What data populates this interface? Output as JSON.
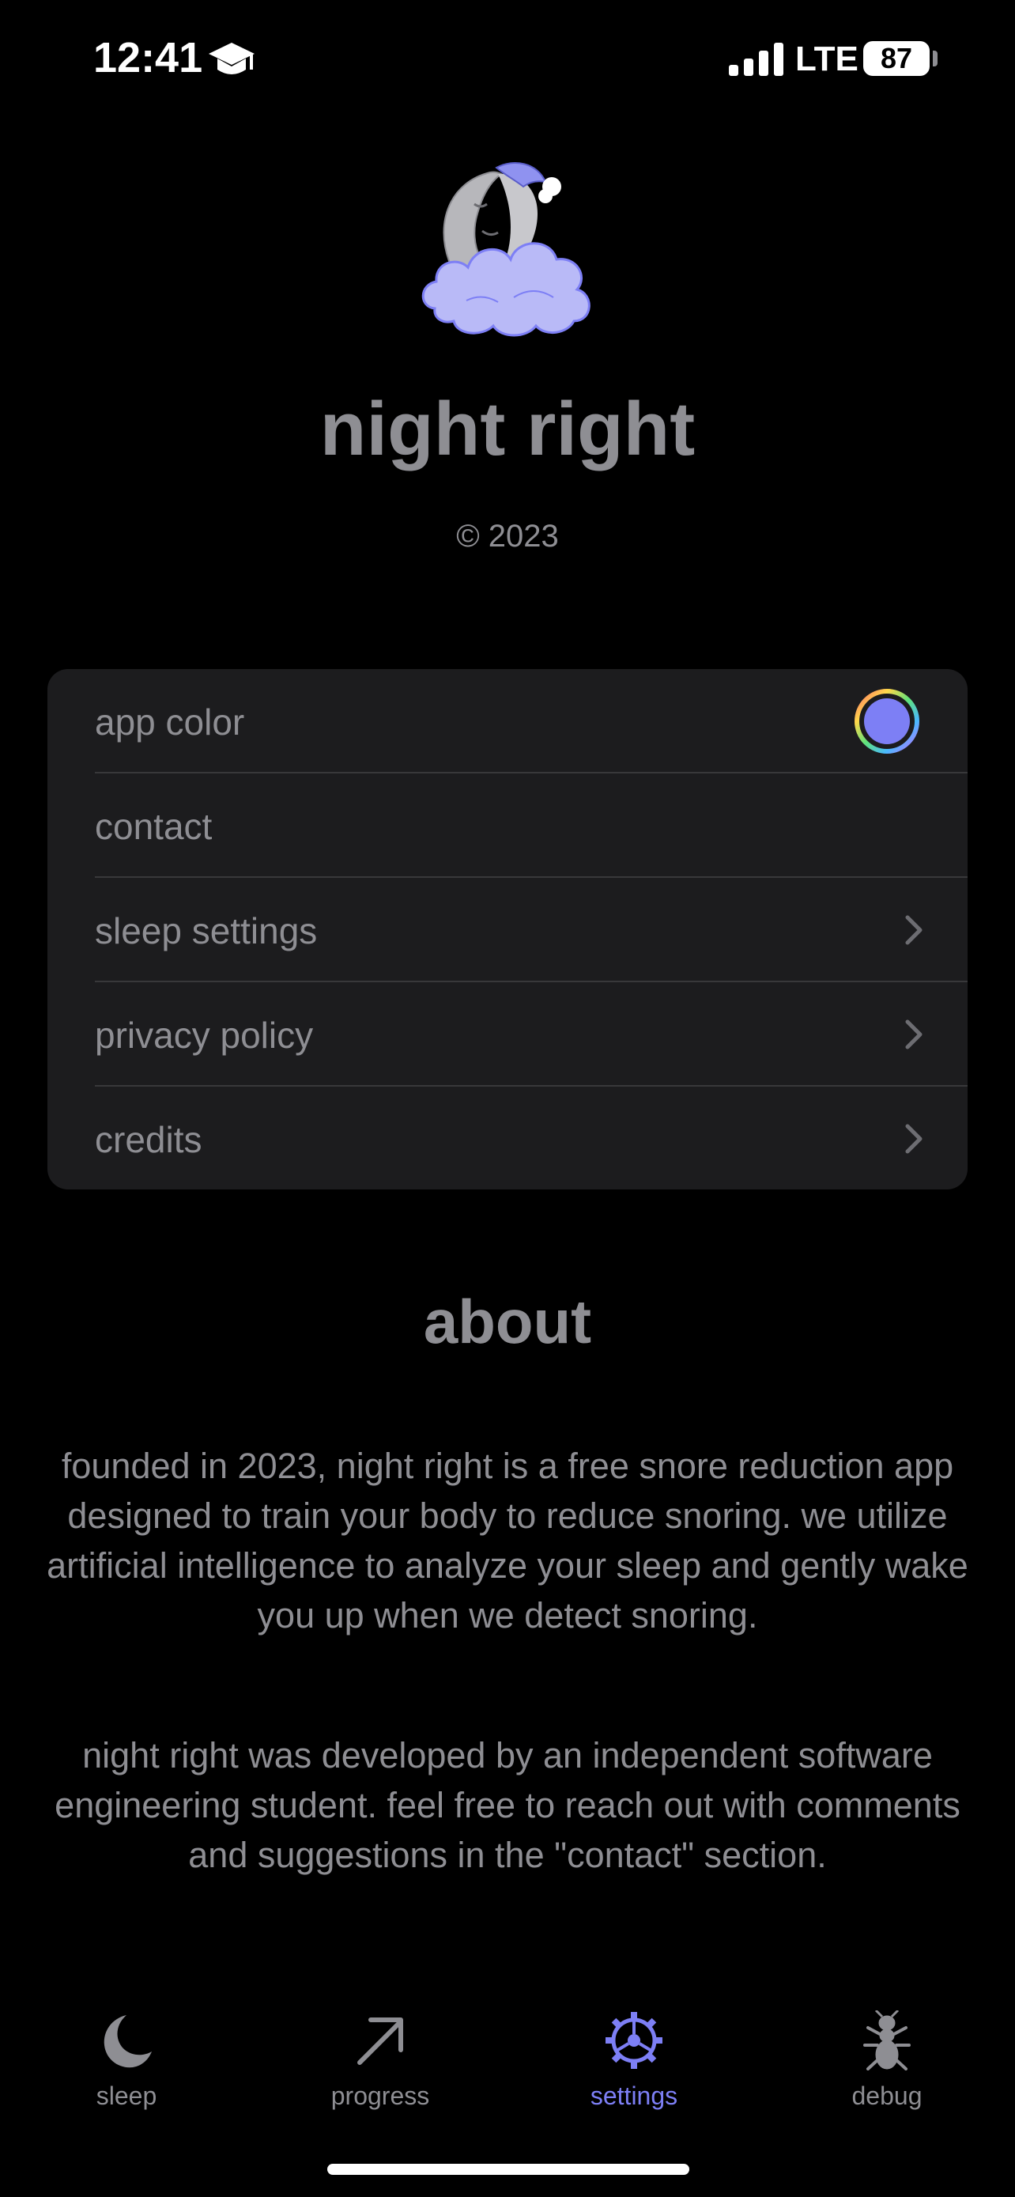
{
  "status_bar": {
    "time": "12:41",
    "network": "LTE",
    "battery": "87",
    "icons": [
      "graduation-cap-icon",
      "signal-bars-icon",
      "battery-icon"
    ]
  },
  "header": {
    "title": "night right",
    "copyright": "© 2023",
    "logo_icon": "sleeping-moon-cloud-logo"
  },
  "settings": {
    "items": [
      {
        "label": "app color",
        "accessory": "color-swatch"
      },
      {
        "label": "contact",
        "accessory": "none"
      },
      {
        "label": "sleep settings",
        "accessory": "chevron-right-icon"
      },
      {
        "label": "privacy policy",
        "accessory": "chevron-right-icon"
      },
      {
        "label": "credits",
        "accessory": "chevron-right-icon"
      }
    ],
    "app_color": "#7d7ff5"
  },
  "about": {
    "title": "about",
    "paragraph1": "founded in 2023, night right is a free snore reduction app designed to train your body to reduce snoring. we utilize artificial intelligence to analyze your sleep and gently wake you up when we detect snoring.",
    "paragraph2": "night right was developed by an independent software engineering student. feel free to reach out with comments and suggestions in the \"contact\" section."
  },
  "tab_bar": {
    "tabs": [
      {
        "label": "sleep",
        "icon": "moon-icon",
        "active": false
      },
      {
        "label": "progress",
        "icon": "arrow-up-right-icon",
        "active": false
      },
      {
        "label": "settings",
        "icon": "gear-icon",
        "active": true
      },
      {
        "label": "debug",
        "icon": "ant-icon",
        "active": false
      }
    ]
  },
  "colors": {
    "background": "#000000",
    "card": "#1c1c1e",
    "text": "#8e8e93",
    "accent": "#7d7ff5"
  }
}
